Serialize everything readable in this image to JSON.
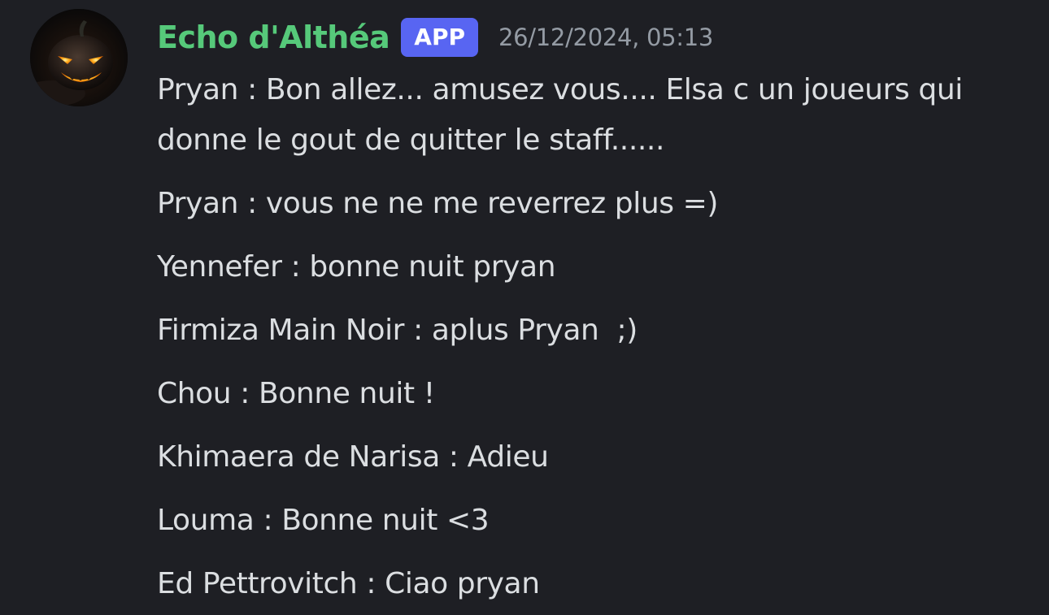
{
  "message": {
    "author": "Echo d'Althéa",
    "badge": "APP",
    "timestamp": "26/12/2024, 05:13",
    "avatar_icon": "jack-o-lantern-icon",
    "lines": [
      "Pryan : Bon allez... amusez vous.... Elsa c un joueurs qui donne le gout de quitter le staff......",
      "Pryan : vous ne ne me reverrez plus =)",
      "Yennefer : bonne nuit pryan",
      "Firmiza Main Noir : aplus Pryan  ;)",
      "Chou : Bonne nuit !",
      "Khimaera de Narisa : Adieu",
      "Louma : Bonne nuit <3",
      "Ed Pettrovitch : Ciao pryan"
    ]
  },
  "colors": {
    "background": "#1e1f24",
    "author": "#56c97a",
    "badge_bg": "#5865f2",
    "timestamp": "#949ba4",
    "text": "#dbdee1"
  }
}
